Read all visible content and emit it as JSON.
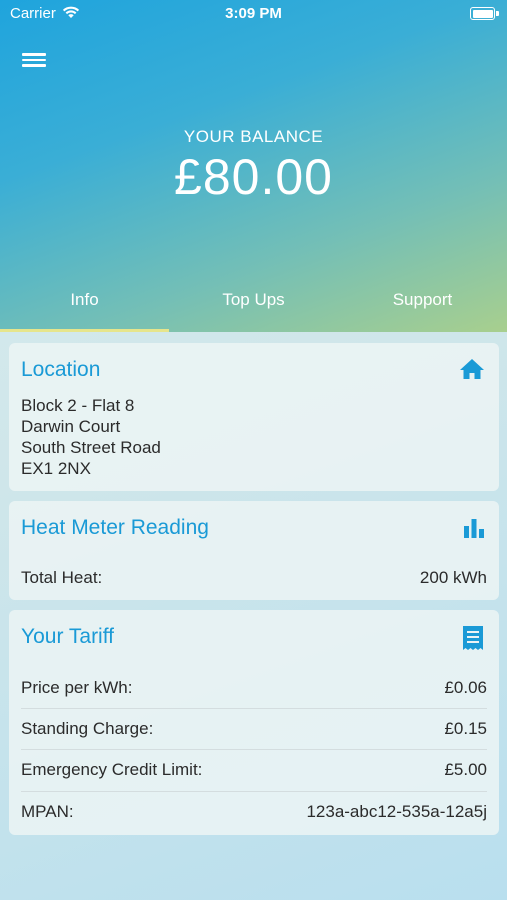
{
  "status_bar": {
    "carrier": "Carrier",
    "time": "3:09 PM"
  },
  "header": {
    "balance_label": "YOUR BALANCE",
    "balance_value": "£80.00"
  },
  "tabs": [
    {
      "label": "Info",
      "active": true
    },
    {
      "label": "Top Ups",
      "active": false
    },
    {
      "label": "Support",
      "active": false
    }
  ],
  "location": {
    "title": "Location",
    "icon": "home-icon",
    "lines": [
      "Block 2 - Flat 8",
      "Darwin Court",
      "South Street Road",
      "EX1 2NX"
    ]
  },
  "heat_meter": {
    "title": "Heat Meter Reading",
    "icon": "bar-chart-icon",
    "label": "Total Heat:",
    "value": "200 kWh"
  },
  "tariff": {
    "title": "Your Tariff",
    "icon": "receipt-icon",
    "rows": [
      {
        "label": "Price per kWh:",
        "value": "£0.06"
      },
      {
        "label": "Standing Charge:",
        "value": "£0.15"
      },
      {
        "label": "Emergency Credit Limit:",
        "value": "£5.00"
      },
      {
        "label": "MPAN:",
        "value": "123a-abc12-535a-12a5j"
      }
    ]
  },
  "colors": {
    "accent": "#1a9ad6",
    "tab_indicator": "#e6e58c"
  }
}
